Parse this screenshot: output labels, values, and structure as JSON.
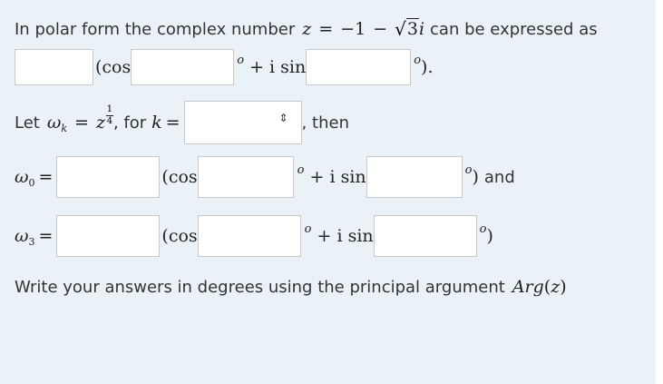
{
  "line1": {
    "intro": "In polar form the complex number",
    "z": "z",
    "eq": "=",
    "minus_one": "−1",
    "minus": "−",
    "sqrt_sym": "√",
    "sqrt_arg": "3",
    "i": "i",
    "suffix": "can be expressed as"
  },
  "line2": {
    "open_cos": "(cos",
    "deg": "o",
    "plus_isin": "+ i sin",
    "close": ")."
  },
  "let_line": {
    "let": "Let",
    "omega": "ω",
    "k": "k",
    "eq": "=",
    "z": "z",
    "num": "1",
    "den": "4",
    "for": ", for",
    "k_var": "k",
    "eq2": "=",
    "then": ", then",
    "select_arrow": "⇕"
  },
  "w0_line": {
    "omega": "ω",
    "sub": "0",
    "eq": "=",
    "open_cos": "(cos",
    "deg": "o",
    "plus_isin": "+ i sin",
    "close": ")",
    "and": "and"
  },
  "w3_line": {
    "omega": "ω",
    "sub": "3",
    "eq": "=",
    "open_cos": "(cos",
    "deg": "o",
    "plus_isin": "+ i sin",
    "close": ")"
  },
  "footer": {
    "text": "Write your answers in degrees using the principal argument",
    "arg": "Arg",
    "arg_open": "(",
    "arg_z": "z",
    "arg_close": ")"
  }
}
